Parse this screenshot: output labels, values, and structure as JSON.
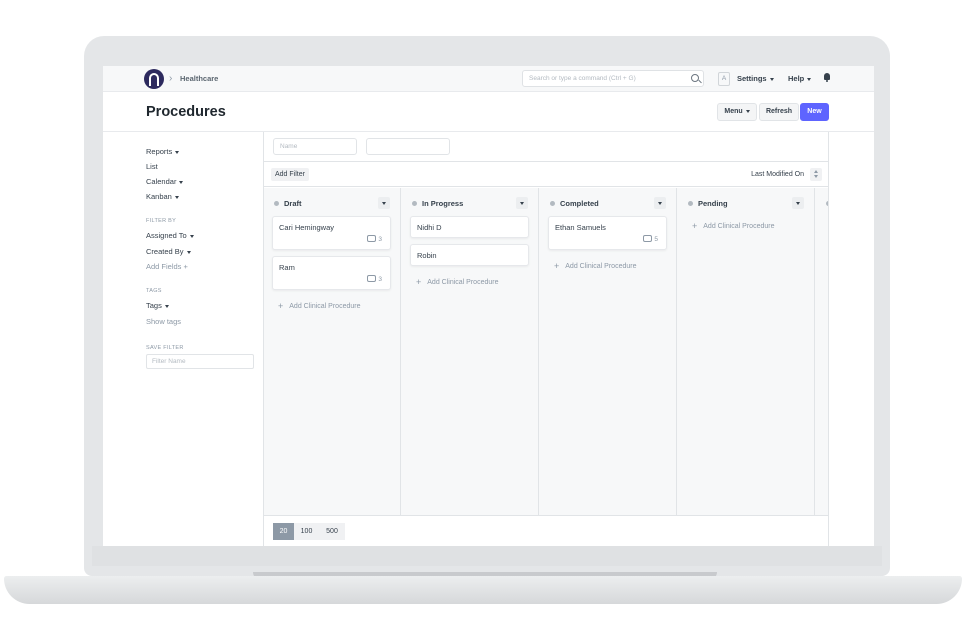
{
  "navbar": {
    "breadcrumb": "Healthcare",
    "search_placeholder": "Search or type a command (Ctrl + G)",
    "avatar_letter": "A",
    "settings_label": "Settings",
    "help_label": "Help"
  },
  "page": {
    "title": "Procedures",
    "menu_label": "Menu",
    "refresh_label": "Refresh",
    "new_label": "New"
  },
  "sidebar": {
    "views": [
      "Reports",
      "List",
      "Calendar",
      "Kanban"
    ],
    "filter_by_heading": "FILTER BY",
    "assigned_to": "Assigned To",
    "created_by": "Created By",
    "add_fields": "Add Fields",
    "tags_heading": "TAGS",
    "tags": "Tags",
    "show_tags": "Show tags",
    "save_filter_heading": "SAVE FILTER",
    "filter_name_placeholder": "Filter Name"
  },
  "filters": {
    "name_placeholder": "Name",
    "add_filter": "Add Filter",
    "sort_label": "Last Modified On"
  },
  "kanban": {
    "add_label": "Add Clinical Procedure",
    "columns": [
      {
        "title": "Draft",
        "cards": [
          {
            "title": "Cari Hemingway",
            "comments": "3"
          },
          {
            "title": "Ram",
            "comments": "3"
          }
        ]
      },
      {
        "title": "In Progress",
        "cards": [
          {
            "title": "Nidhi D"
          },
          {
            "title": "Robin"
          }
        ]
      },
      {
        "title": "Completed",
        "cards": [
          {
            "title": "Ethan Samuels",
            "comments": "5"
          }
        ]
      },
      {
        "title": "Pending",
        "cards": []
      }
    ]
  },
  "paging": [
    "20",
    "100",
    "500"
  ],
  "colors": {
    "primary": "#5e64ff",
    "text": "#36414c",
    "muted": "#8d99a6"
  }
}
